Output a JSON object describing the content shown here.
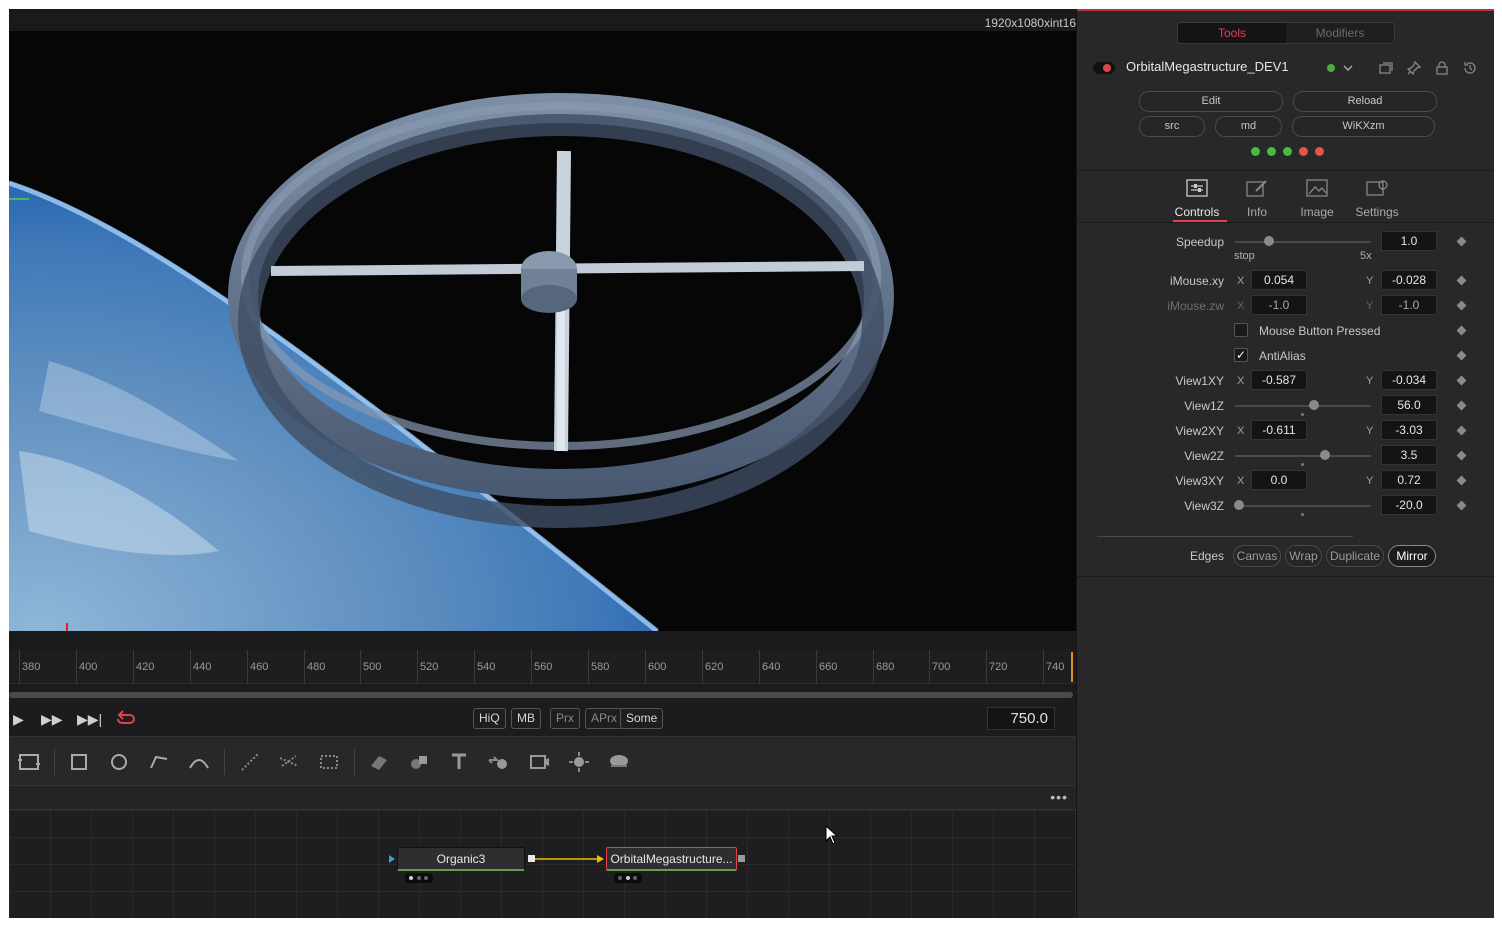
{
  "viewer": {
    "resolution": "1920x1080xint16"
  },
  "timeline": {
    "ticks": [
      "380",
      "400",
      "420",
      "440",
      "460",
      "480",
      "500",
      "520",
      "540",
      "560",
      "580",
      "600",
      "620",
      "640",
      "660",
      "680",
      "700",
      "720",
      "740"
    ],
    "current_frame": "750.0"
  },
  "transport": {
    "toggles": [
      {
        "label": "HiQ",
        "on": true
      },
      {
        "label": "MB",
        "on": true
      },
      {
        "label": "Prx",
        "on": false
      },
      {
        "label": "APrx",
        "on": false
      },
      {
        "label": "Some",
        "on": true
      }
    ]
  },
  "toolbar": {
    "icons": [
      "transform-icon",
      "rectangle-mask-icon",
      "ellipse-mask-icon",
      "polygon-mask-icon",
      "bspline-mask-icon",
      "particle-emitter-icon",
      "particle-render-icon",
      "particle-stack-icon",
      "image-plane-3d-icon",
      "shape-3d-icon",
      "text-3d-icon",
      "merge-3d-icon",
      "camera-3d-icon",
      "light-3d-icon",
      "renderer-3d-icon"
    ]
  },
  "node_graph": {
    "more_menu": "•••",
    "nodes": [
      {
        "name": "Organic3"
      },
      {
        "name": "OrbitalMegastructure..."
      }
    ]
  },
  "inspector": {
    "tabs_top": {
      "tools": "Tools",
      "modifiers": "Modifiers"
    },
    "tool_name": "OrbitalMegastructure_DEV1",
    "buttons_row1": {
      "edit": "Edit",
      "reload": "Reload"
    },
    "buttons_row2": {
      "src": "src",
      "md": "md",
      "wikxzm": "WiKXzm"
    },
    "leds": [
      "#3fbf3a",
      "#3fbf3a",
      "#3fbf3a",
      "#e2553f",
      "#e2553f"
    ],
    "tabs": [
      {
        "label": "Controls",
        "icon": "sliders-icon",
        "active": true
      },
      {
        "label": "Info",
        "icon": "info-edit-icon",
        "active": false
      },
      {
        "label": "Image",
        "icon": "image-icon",
        "active": false
      },
      {
        "label": "Settings",
        "icon": "settings-icon",
        "active": false
      }
    ],
    "params": {
      "speedup": {
        "label": "Speedup",
        "value": "1.0",
        "min_label": "stop",
        "max_label": "5x",
        "level": 0.25
      },
      "imouse_xy": {
        "label": "iMouse.xy",
        "x": "0.054",
        "y": "-0.028"
      },
      "imouse_zw": {
        "label": "iMouse.zw",
        "x": "-1.0",
        "y": "-1.0"
      },
      "mouse_button": {
        "label": "Mouse Button Pressed",
        "checked": false
      },
      "antialias": {
        "label": "AntiAlias",
        "checked": true
      },
      "view1xy": {
        "label": "View1XY",
        "x": "-0.587",
        "y": "-0.034"
      },
      "view1z": {
        "label": "View1Z",
        "value": "56.0",
        "level": 0.58
      },
      "view2xy": {
        "label": "View2XY",
        "x": "-0.611",
        "y": "-3.03"
      },
      "view2z": {
        "label": "View2Z",
        "value": "3.5",
        "level": 0.66
      },
      "view3xy": {
        "label": "View3XY",
        "x": "0.0",
        "y": "0.72"
      },
      "view3z": {
        "label": "View3Z",
        "value": "-20.0",
        "level": 0.03
      }
    },
    "axis_x": "X",
    "axis_y": "Y",
    "edges": {
      "label": "Edges",
      "options": [
        {
          "label": "Canvas",
          "active": false
        },
        {
          "label": "Wrap",
          "active": false
        },
        {
          "label": "Duplicate",
          "active": false
        },
        {
          "label": "Mirror",
          "active": true
        }
      ]
    }
  },
  "colors": {
    "accent_red": "#e0434b",
    "node_link": "#e8c000",
    "playhead": "#e09020"
  }
}
